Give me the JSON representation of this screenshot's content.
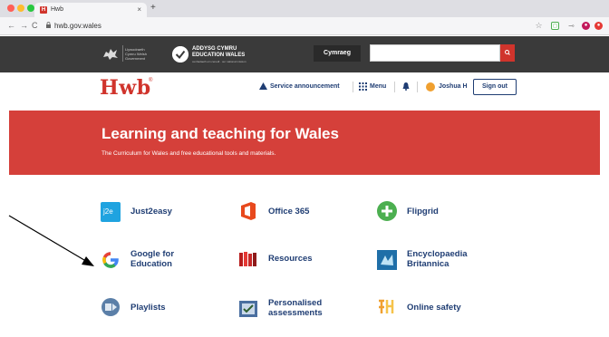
{
  "browser": {
    "tab_title": "Hwb",
    "tab_favicon": "H",
    "tab_close": "×",
    "new_tab": "+",
    "url": "hwb.gov.wales",
    "nav": {
      "back": "←",
      "forward": "→",
      "reload": "C"
    },
    "extensions": [
      {
        "icon": "star-icon",
        "color": "#888888"
      },
      {
        "icon": "green-extension-icon",
        "color": "#4caf50"
      },
      {
        "icon": "key-icon",
        "color": "#888888"
      },
      {
        "icon": "profile-icon",
        "color": "#c2185b"
      },
      {
        "icon": "red-extension-icon",
        "color": "#e53935"
      }
    ]
  },
  "gov_header": {
    "welsh_gov_text": "Llywodraeth Cymru Welsh Government",
    "ewales_line1": "ADDYSG CYMRU",
    "ewales_line2": "EDUCATION WALES",
    "ewales_sub": "cenhadaeth ein cenedl · our national mission",
    "language_button": "Cymraeg",
    "search_placeholder": "",
    "search_icon": "search-icon"
  },
  "site_header": {
    "logo": "Hwb",
    "logo_mark": "®",
    "service_announcement": "Service announcement",
    "menu": "Menu",
    "user_name": "Joshua H",
    "sign_out": "Sign out"
  },
  "hero": {
    "title": "Learning and teaching for Wales",
    "subtitle": "The Curriculum for Wales and free educational tools and materials."
  },
  "tiles": [
    {
      "label": "Just2easy",
      "icon": "just2easy-icon"
    },
    {
      "label": "Office 365",
      "icon": "office365-icon"
    },
    {
      "label": "Flipgrid",
      "icon": "flipgrid-icon"
    },
    {
      "label": "Google for Education",
      "line1": "Google for",
      "line2": "Education",
      "icon": "google-icon"
    },
    {
      "label": "Resources",
      "icon": "resources-icon"
    },
    {
      "label": "Encyclopaedia Britannica",
      "line1": "Encyclopaedia",
      "line2": "Britannica",
      "icon": "britannica-icon"
    },
    {
      "label": "Playlists",
      "icon": "playlists-icon"
    },
    {
      "label": "Personalised assessments",
      "line1": "Personalised",
      "line2": "assessments",
      "icon": "assessments-icon"
    },
    {
      "label": "Online safety",
      "icon": "online-safety-icon"
    }
  ],
  "colors": {
    "brand_red": "#d0342c",
    "hero_red": "#d5403a",
    "navy": "#1f3d73",
    "gov_bar": "#3a3a3a"
  }
}
